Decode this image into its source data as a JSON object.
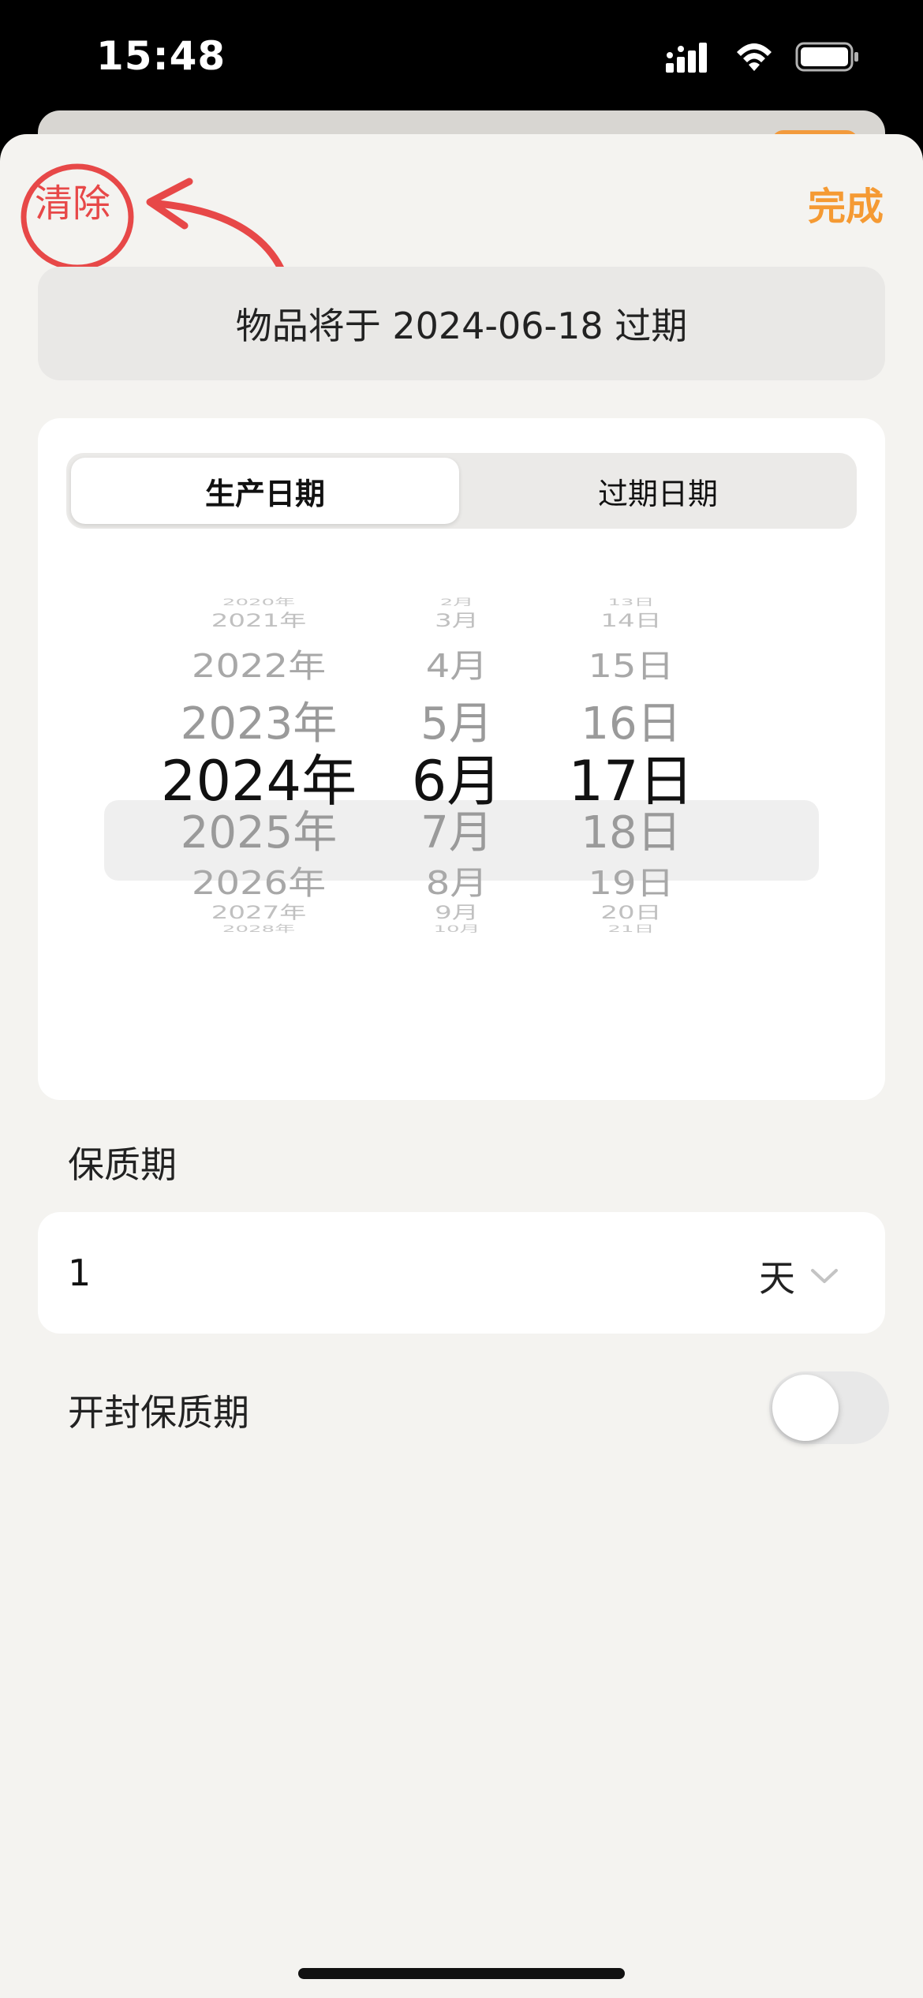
{
  "status": {
    "time": "15:48"
  },
  "header": {
    "clear_label": "清除",
    "done_label": "完成",
    "accent_color": "#F59A33",
    "annotation_color": "#E74848"
  },
  "banner": {
    "text": "物品将于 2024-06-18 过期"
  },
  "segments": {
    "production": "生产日期",
    "expiry": "过期日期",
    "selected": "production"
  },
  "picker": {
    "years": [
      "2020年",
      "2021年",
      "2022年",
      "2023年",
      "2024年",
      "2025年",
      "2026年",
      "2027年",
      "2028年"
    ],
    "months": [
      "2月",
      "3月",
      "4月",
      "5月",
      "6月",
      "7月",
      "8月",
      "9月",
      "10月"
    ],
    "days": [
      "13日",
      "14日",
      "15日",
      "16日",
      "17日",
      "18日",
      "19日",
      "20日",
      "21日"
    ],
    "selected": {
      "year": "2024年",
      "month": "6月",
      "day": "17日"
    }
  },
  "shelf_life": {
    "label": "保质期",
    "value": "1",
    "unit": "天"
  },
  "opened_shelf_life": {
    "label": "开封保质期",
    "enabled": false
  },
  "icons": [
    "cellular-signal-icon",
    "wifi-icon",
    "battery-icon",
    "chevron-down-icon",
    "annotation-arrow-icon"
  ]
}
